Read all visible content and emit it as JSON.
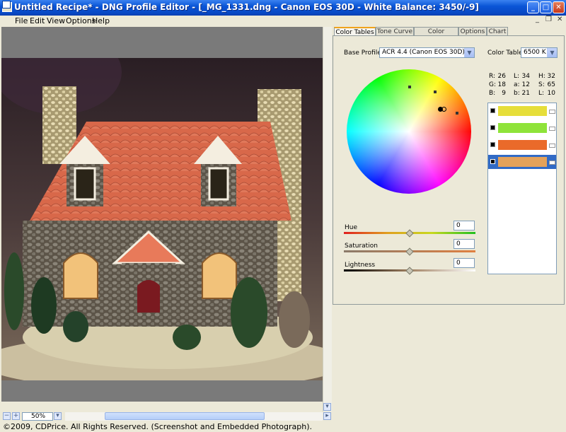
{
  "window": {
    "title": "Untitled Recipe* - DNG Profile Editor - [_MG_1331.dng  - Canon EOS 30D - White Balance: 3450/-9]",
    "minimize": "_",
    "maximize": "□",
    "close": "✕"
  },
  "menu": {
    "items": [
      "File",
      "Edit",
      "View",
      "Options",
      "Help"
    ],
    "mdi_min": "_",
    "mdi_restore": "❐",
    "mdi_close": "✕"
  },
  "tabs": [
    "Color Tables",
    "Tone Curve",
    "Color Matrices",
    "Options",
    "Chart"
  ],
  "color_tables": {
    "base_profile_label": "Base Profile:",
    "base_profile_value": "ACR 4.4 (Canon EOS 30D)",
    "color_table_label": "Color Table:",
    "color_table_value": "6500 K",
    "readout": {
      "r_label": "R:",
      "r": "26",
      "l_label": "L:",
      "l": "34",
      "h_label": "H:",
      "h": "32",
      "g_label": "G:",
      "g": "18",
      "a_label": "a:",
      "a": "12",
      "s_label": "S:",
      "s": "65",
      "b_label": "B:",
      "b": "9",
      "b2_label": "b:",
      "b2": "21",
      "l2_label": "L:",
      "l2": "10"
    },
    "sliders": [
      {
        "label": "Hue",
        "value": "0",
        "level": 0.5
      },
      {
        "label": "Saturation",
        "value": "0",
        "level": 0.5
      },
      {
        "label": "Lightness",
        "value": "0",
        "level": 0.5
      }
    ],
    "color_rows": [
      {
        "color": "#e6de3a",
        "selected": false
      },
      {
        "color": "#8fe33a",
        "selected": false
      },
      {
        "color": "#ea6a2a",
        "selected": false
      },
      {
        "color": "#e4a25a",
        "selected": true
      }
    ]
  },
  "zoom": "50%",
  "copyright": "©2009, CDPrice. All Rights Reserved. (Screenshot and Embedded Photograph)."
}
